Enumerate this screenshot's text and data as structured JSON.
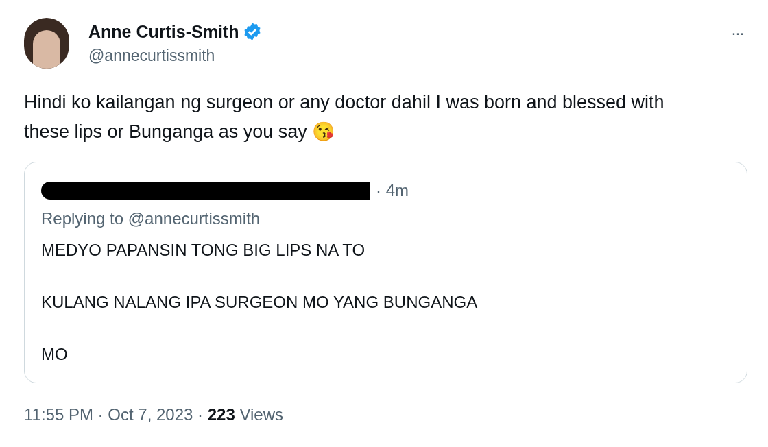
{
  "author": {
    "name": "Anne Curtis-Smith",
    "verified": true,
    "handle": "@annecurtissmith"
  },
  "more_button": "···",
  "text": "Hindi ko kailangan ng surgeon or any doctor dahil I was born and blessed with these lips or Bunganga as you say 😘",
  "quoted_tweet": {
    "author_redacted": true,
    "time": "· 4m",
    "replying_to": "Replying to @annecurtissmith",
    "paragraphs": [
      "MEDYO PAPANSIN TONG BIG LIPS NA TO",
      "KULANG NALANG IPA SURGEON MO YANG BUNGANGA",
      "MO"
    ]
  },
  "footer": "11:55 PM · Oct 7, 2023 · **223** Views"
}
